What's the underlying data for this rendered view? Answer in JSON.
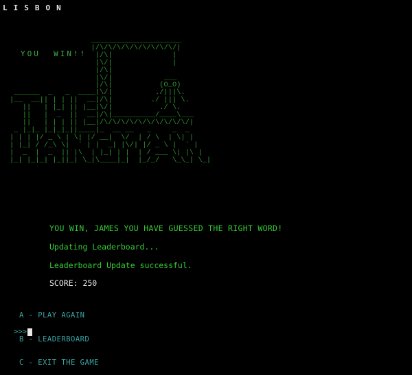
{
  "secret_word": "LISBON",
  "result_banner": "YOU  WIN!!",
  "ascii_art": "                   _____________________\n                   |/\\/\\/\\/\\/\\/\\/\\/\\/\\/|\n                    |/\\|              |\n                    |\\/|              |\n                    |/\\|\n                    |\\/|            ___\n                    |/\\|           (O_O)\n ______  _   _  ____|\\/|          ./|||\\.\n|__  __|| | | ||  __|/\\|         ./ ||| \\.\n   ||   | |_| || |__|\\/|           ./ \\.\n   ||   |  _  ||  __|/\\|__________/____\\___\n   ||   | | | || |__|/\\/\\/\\/\\/\\/\\/\\/\\/\\/\\/|\n _ |_|_ |_|_|_||____|_  __ __   _     _  _\n| | | |/ _ \\ | \\| |/ __|  \\/  | / \\  | \\| |\n| |_| / /_\\ \\|  ` | |  _| |\\/| |/ _ \\ |  ` |\n|  _  |  _  || |\\  | |_| | |  | / ___ \\| |\\ |\n|_| |_|_| |_||_| \\_|\\____|_|  |_/_/   \\_\\_| \\_|",
  "messages": {
    "win": "YOU WIN, JAMES YOU HAVE GUESSED THE RIGHT WORD!",
    "updating": "Updating Leaderboard...",
    "success": "Leaderboard Update successful."
  },
  "score": "SCORE: 250",
  "menu": [
    "A - PLAY AGAIN",
    "B - LEADERBOARD",
    "C - EXIT THE GAME"
  ],
  "prompt": ">>>",
  "colors": {
    "background": "#000000",
    "green": "#33cc33",
    "cyan": "#3aa6a6",
    "white": "#e8e8e8"
  }
}
